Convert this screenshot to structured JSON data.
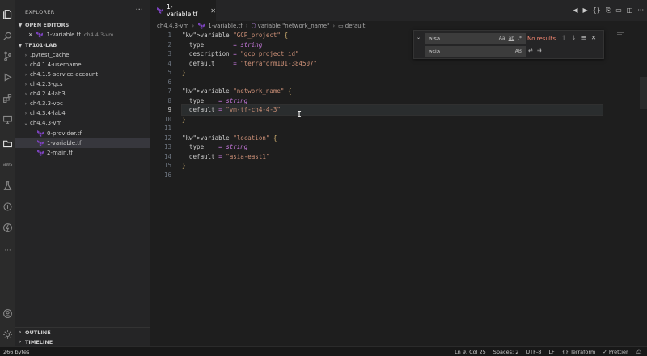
{
  "sidebar": {
    "title": "EXPLORER",
    "more": "···",
    "open_editors": {
      "label": "OPEN EDITORS",
      "items": [
        {
          "close": "✕",
          "name": "1-variable.tf",
          "folder": "ch4.4.3-vm"
        }
      ]
    },
    "workspace": {
      "label": "TF101-LAB",
      "items": [
        {
          "name": ".pytest_cache",
          "kind": "folder",
          "expanded": false
        },
        {
          "name": "ch4.1.4-username",
          "kind": "folder",
          "expanded": false
        },
        {
          "name": "ch4.1.5-service-account",
          "kind": "folder",
          "expanded": false
        },
        {
          "name": "ch4.2.3-gcs",
          "kind": "folder",
          "expanded": false
        },
        {
          "name": "ch4.2.4-lab3",
          "kind": "folder",
          "expanded": false
        },
        {
          "name": "ch4.3.3-vpc",
          "kind": "folder",
          "expanded": false
        },
        {
          "name": "ch4.3.4-lab4",
          "kind": "folder",
          "expanded": false
        },
        {
          "name": "ch4.4.3-vm",
          "kind": "folder",
          "expanded": true
        },
        {
          "name": "0-provider.tf",
          "kind": "file"
        },
        {
          "name": "1-variable.tf",
          "kind": "file",
          "selected": true
        },
        {
          "name": "2-main.tf",
          "kind": "file"
        }
      ]
    },
    "outline_label": "OUTLINE",
    "timeline_label": "TIMELINE"
  },
  "tab": {
    "label": "1-variable.tf",
    "close": "✕"
  },
  "breadcrumb": {
    "folder": "ch4.4.3-vm",
    "file": "1-variable.tf",
    "symbol": "variable \"network_name\"",
    "member": "default"
  },
  "editor": {
    "current_line": 9,
    "lines": [
      {
        "n": "1",
        "text": "variable \"GCP_project\" {"
      },
      {
        "n": "2",
        "text": "  type        = string"
      },
      {
        "n": "3",
        "text": "  description = \"gcp project id\""
      },
      {
        "n": "4",
        "text": "  default     = \"terraform101-384507\""
      },
      {
        "n": "5",
        "text": "}"
      },
      {
        "n": "6",
        "text": ""
      },
      {
        "n": "7",
        "text": "variable \"network_name\" {"
      },
      {
        "n": "8",
        "text": "  type    = string"
      },
      {
        "n": "9",
        "text": "  default = \"vm-tf-ch4-4-3\""
      },
      {
        "n": "10",
        "text": "}"
      },
      {
        "n": "11",
        "text": ""
      },
      {
        "n": "12",
        "text": "variable \"location\" {"
      },
      {
        "n": "13",
        "text": "  type    = string"
      },
      {
        "n": "14",
        "text": "  default = \"asia-east1\""
      },
      {
        "n": "15",
        "text": "}"
      },
      {
        "n": "16",
        "text": ""
      }
    ]
  },
  "find_widget": {
    "find_value": "aisa",
    "replace_value": "asia",
    "result": "No results",
    "find_options": [
      "Aa",
      "ab",
      ".*"
    ],
    "replace_option": "AB"
  },
  "status": {
    "left": "266 bytes",
    "position": "Ln 9, Col 25",
    "spaces": "Spaces: 2",
    "encoding": "UTF-8",
    "eol": "LF",
    "language": "Terraform",
    "formatter": "Prettier"
  },
  "colors": {
    "terraform_icon": "#7b42bc",
    "no_results": "#f48771",
    "keyword": "#e5c07b",
    "type_keyword": "#c678dd"
  }
}
